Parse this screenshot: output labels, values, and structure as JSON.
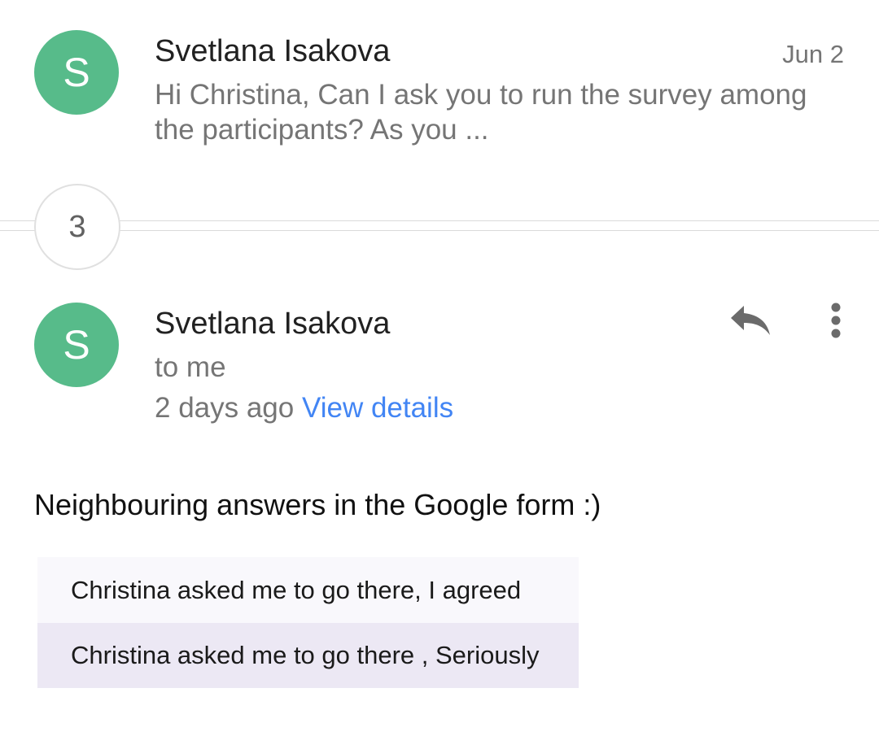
{
  "colors": {
    "avatar_bg": "#57bb8a",
    "link": "#4285f4",
    "row_alt_1": "#f9f8fc",
    "row_alt_2": "#ece8f4"
  },
  "collapsed_message": {
    "avatar_letter": "S",
    "sender": "Svetlana Isakova",
    "date": "Jun 2",
    "snippet": "Hi Christina, Can I ask you to run the survey among the participants? As you ..."
  },
  "collapsed_count": "3",
  "open_message": {
    "avatar_letter": "S",
    "sender": "Svetlana Isakova",
    "recipient": "to me",
    "time": "2 days ago",
    "view_details": "View details",
    "reply_icon": "reply-icon",
    "more_icon": "more-vert-icon",
    "body": "Neighbouring answers in the Google form :)",
    "form_rows": [
      "Christina asked me to go there, I agreed",
      "Christina asked me to go there , Seriously"
    ]
  }
}
